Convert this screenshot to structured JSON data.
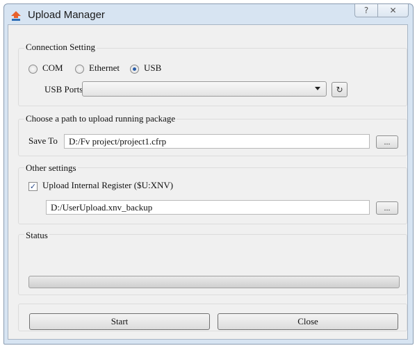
{
  "window": {
    "title": "Upload Manager",
    "help_symbol": "?",
    "close_symbol": "✕"
  },
  "connection": {
    "title": "Connection Setting",
    "options": [
      "COM",
      "Ethernet",
      "USB"
    ],
    "selected": "USB",
    "usb_ports_label": "USB Ports",
    "usb_ports_value": "",
    "refresh_symbol": "↻"
  },
  "package": {
    "title": "Choose a path to upload running package",
    "save_to_label": "Save To",
    "save_to_value": "D:/Fv project/project1.cfrp",
    "browse_label": "..."
  },
  "other": {
    "title": "Other settings",
    "checkbox_label": "Upload Internal Register ($U:XNV)",
    "checked": true,
    "path_value": "D:/UserUpload.xnv_backup",
    "browse_label": "..."
  },
  "status": {
    "title": "Status",
    "progress": 0
  },
  "actions": {
    "start_label": "Start",
    "close_label": "Close"
  },
  "colors": {
    "frame": "#d7e4f2",
    "client": "#f0f0f0",
    "radio_dot": "#2a5da8"
  }
}
